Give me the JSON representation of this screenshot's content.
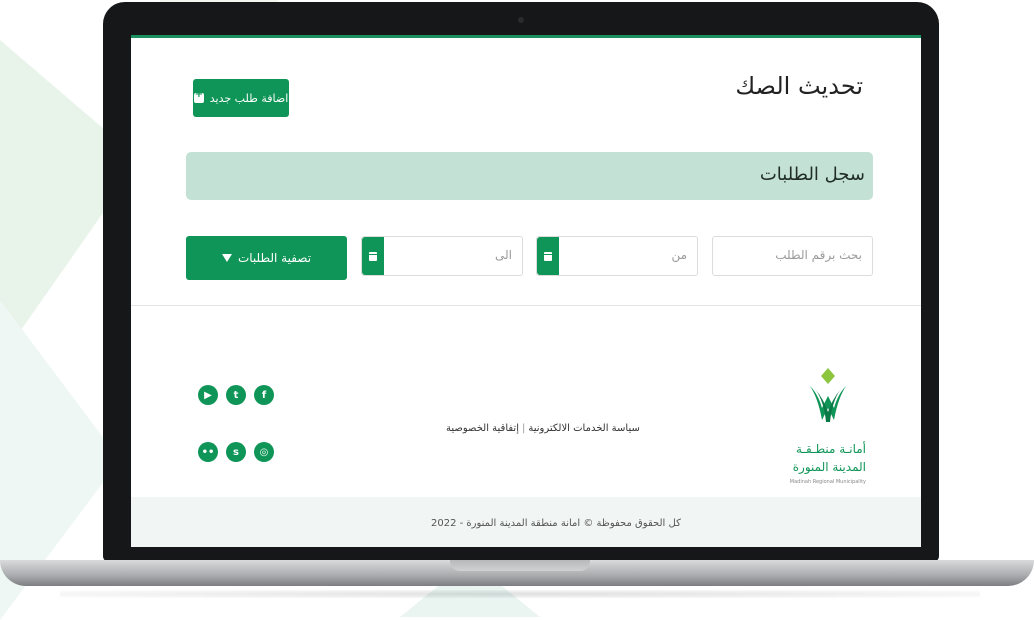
{
  "page": {
    "title": "تحديث الصك",
    "add_button_label": "اضافة طلب جديد",
    "section_title": "سجل الطلبات"
  },
  "filters": {
    "search_placeholder": "بحث برقم الطلب",
    "from_placeholder": "من",
    "to_placeholder": "الى",
    "filter_button_label": "تصفية الطلبات"
  },
  "footer": {
    "logo_line1": "أمانـة منطـقـة",
    "logo_line2": "المدينة المنورة",
    "logo_en": "Madinah Regional Municipality",
    "link_policy": "سياسة الخدمات الالكترونية",
    "link_privacy": "إتفاقية الخصوصية",
    "separator": "|",
    "copyright": "كل الحقوق محفوظة © امانة منطقة المدينة المنورة - 2022",
    "social": {
      "facebook": "f",
      "twitter": "t",
      "youtube": "▶",
      "instagram": "◎",
      "snapchat": "s",
      "flickr": "••"
    }
  },
  "colors": {
    "brand_green": "#0f9557",
    "section_bg": "#c4e1d5"
  }
}
